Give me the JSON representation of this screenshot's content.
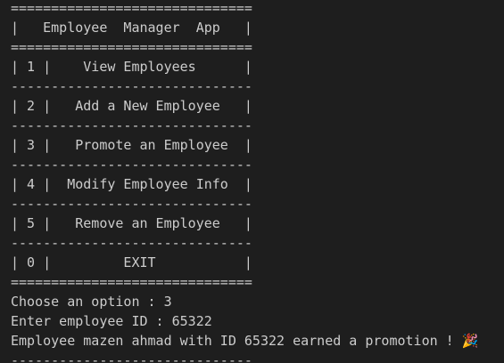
{
  "terminal": {
    "lines": [
      "==============================",
      "|   Employee  Manager  App   |",
      "==============================",
      "| 1 |    View Employees      |",
      "------------------------------",
      "| 2 |   Add a New Employee   |",
      "------------------------------",
      "| 3 |   Promote an Employee  |",
      "------------------------------",
      "| 4 |  Modify Employee Info  |",
      "------------------------------",
      "| 5 |   Remove an Employee   |",
      "------------------------------",
      "| 0 |         EXIT           |",
      "==============================",
      "Choose an option : 3",
      "Enter employee ID : 65322",
      "Employee mazen ahmad with ID 65322 earned a promotion ! 🎉",
      "------------------------------"
    ]
  }
}
